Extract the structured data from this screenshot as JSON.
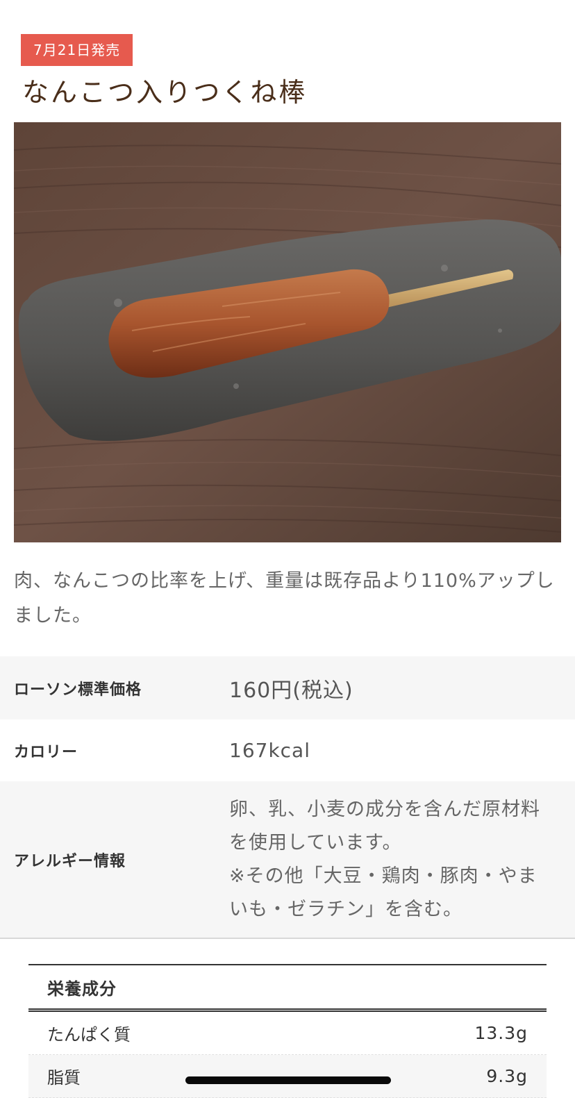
{
  "product": {
    "release_badge": "7月21日発売",
    "title": "なんこつ入りつくね棒",
    "description": "肉、なんこつの比率を上げ、重量は既存品より110%アップしました。",
    "photo_alt": "なんこつ入りつくね棒"
  },
  "info": {
    "price": {
      "label": "ローソン標準価格",
      "value": "160円(税込)"
    },
    "calorie": {
      "label": "カロリー",
      "value": "167kcal"
    },
    "allergy": {
      "label": "アレルギー情報",
      "line1": "卵、乳、小麦の成分を含んだ原材料を使用しています。",
      "line2": "※その他「大豆・鶏肉・豚肉・やまいも・ゼラチン」を含む。"
    }
  },
  "nutrition": {
    "header": "栄養成分",
    "rows": [
      {
        "name": "たんぱく質",
        "value": "13.3g"
      },
      {
        "name": "脂質",
        "value": "9.3g"
      }
    ]
  },
  "colors": {
    "badge": "#e65a4e",
    "title": "#4a2e1a",
    "row_shade": "#f6f6f6"
  }
}
